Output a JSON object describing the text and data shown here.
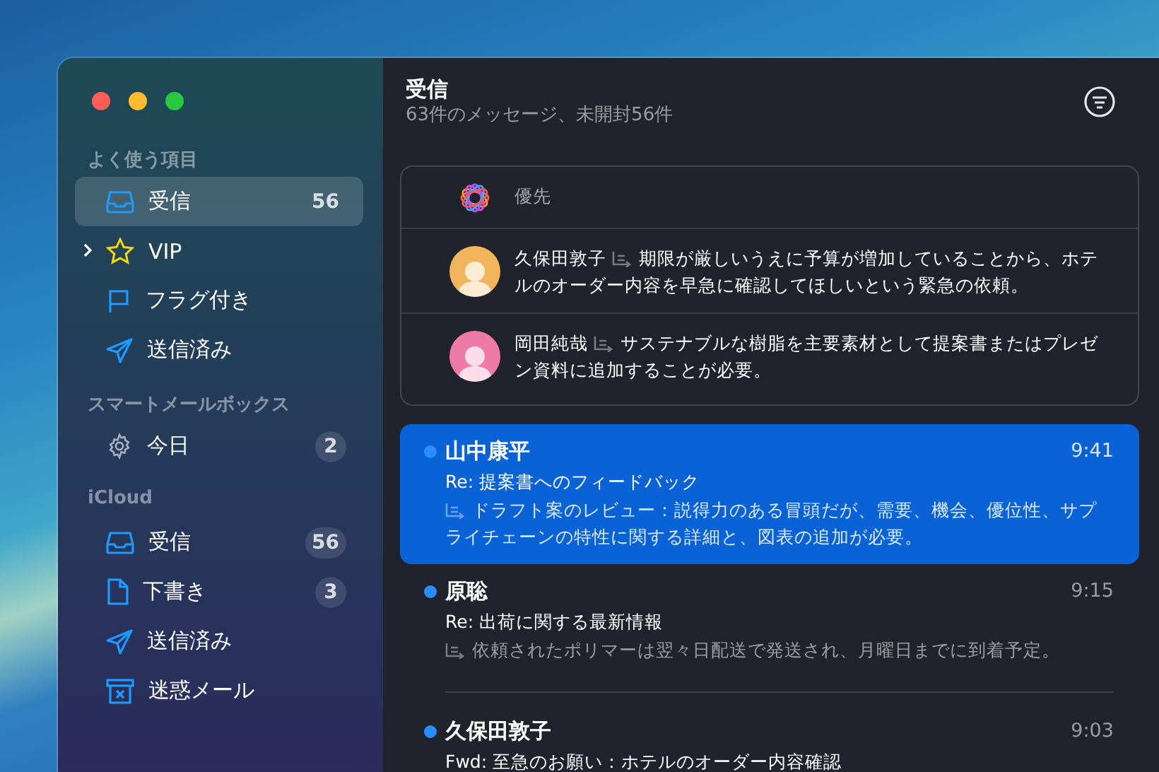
{
  "sidebar": {
    "sections": [
      {
        "title": "よく使う項目",
        "items": [
          {
            "kind": "inbox",
            "label": "受信",
            "count": "56",
            "selected": true
          },
          {
            "kind": "vip",
            "label": "VIP",
            "expanded": false,
            "selected": false
          },
          {
            "kind": "flag",
            "label": "フラグ付き",
            "selected": false
          },
          {
            "kind": "sent",
            "label": "送信済み",
            "selected": false
          }
        ]
      },
      {
        "title": "スマートメールボックス",
        "items": [
          {
            "kind": "smart",
            "label": "今日",
            "count": "2",
            "selected": false
          }
        ]
      },
      {
        "title": "iCloud",
        "items": [
          {
            "kind": "inbox",
            "label": "受信",
            "count": "56",
            "selected": false
          },
          {
            "kind": "drafts",
            "label": "下書き",
            "count": "3",
            "selected": false
          },
          {
            "kind": "sent",
            "label": "送信済み",
            "selected": false
          },
          {
            "kind": "junk",
            "label": "迷惑メール",
            "selected": false
          }
        ]
      }
    ]
  },
  "mailbox": {
    "title": "受信",
    "subtitle": "63件のメッセージ、未開封56件"
  },
  "priority": {
    "title": "優先",
    "items": [
      {
        "sender": "久保田敦子",
        "summary": "期限が厳しいうえに予算が増加していることから、ホテルのオーダー内容を早急に確認してほしいという緊急の依頼。",
        "color": "#f2b55c"
      },
      {
        "sender": "岡田純哉",
        "summary": "サステナブルな樹脂を主要素材として提案書またはプレゼン資料に追加することが必要。",
        "color": "#ee7ba5"
      }
    ]
  },
  "messages": [
    {
      "sender": "山中康平",
      "time": "9:41",
      "subject": "Re: 提案書へのフィードバック",
      "summary": "ドラフト案のレビュー：説得力のある冒頭だが、需要、機会、優位性、サプライチェーンの特性に関する詳細と、図表の追加が必要。",
      "unread": true,
      "selected": true
    },
    {
      "sender": "原聡",
      "time": "9:15",
      "subject": "Re: 出荷に関する最新情報",
      "summary": "依頼されたポリマーは翌々日配送で発送され、月曜日までに到着予定。",
      "unread": true,
      "selected": false
    },
    {
      "sender": "久保田敦子",
      "time": "9:03",
      "subject": "Fwd: 至急のお願い：ホテルのオーダー内容確認",
      "unread": true,
      "selected": false
    }
  ]
}
